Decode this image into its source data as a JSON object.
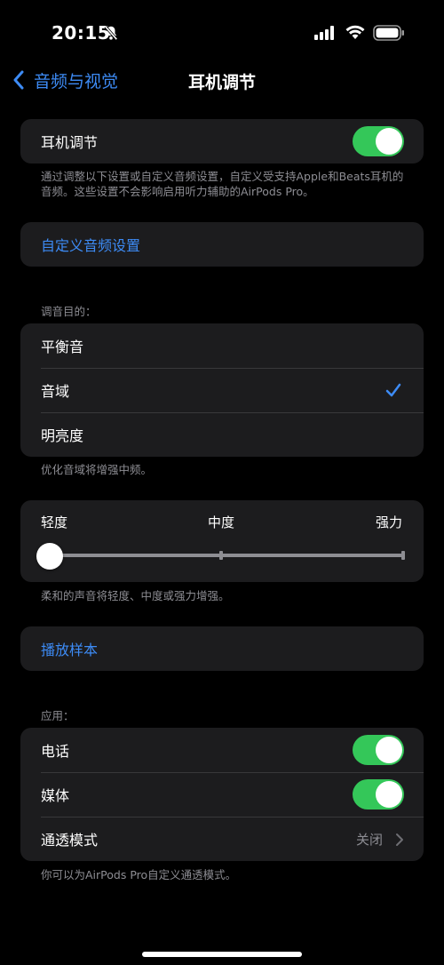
{
  "status_bar": {
    "time": "20:15"
  },
  "nav": {
    "back_label": "音频与视觉",
    "title": "耳机调节"
  },
  "headphone_toggle": {
    "label": "耳机调节",
    "on": true
  },
  "footnote_top": "通过调整以下设置或自定义音频设置，自定义受支持Apple和Beats耳机的音频。这些设置不会影响启用听力辅助的AirPods Pro。",
  "custom_audio_label": "自定义音频设置",
  "tune_header": "调音目的：",
  "tune_options": [
    {
      "label": "平衡音",
      "selected": false
    },
    {
      "label": "音域",
      "selected": true
    },
    {
      "label": "明亮度",
      "selected": false
    }
  ],
  "tune_footnote": "优化音域将增强中频。",
  "strength": {
    "labels": [
      "轻度",
      "中度",
      "强力"
    ],
    "value": 0
  },
  "strength_footnote": "柔和的声音将轻度、中度或强力增强。",
  "play_sample_label": "播放样本",
  "apply_header": "应用：",
  "apply": {
    "phone": {
      "label": "电话",
      "on": true
    },
    "media": {
      "label": "媒体",
      "on": true
    },
    "transparency": {
      "label": "通透模式",
      "value": "关闭"
    }
  },
  "apply_footnote": "你可以为AirPods Pro自定义通透模式。",
  "colors": {
    "accent": "#3d8bf5",
    "toggle_on": "#34c759",
    "cell": "#1c1c1e",
    "secondary_text": "#8d8d93"
  }
}
